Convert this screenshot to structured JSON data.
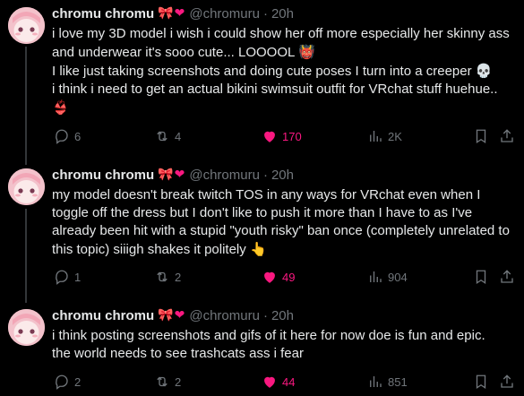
{
  "tweets": [
    {
      "name": "chromu chromu",
      "bow": "🎀",
      "heart": "❤",
      "handle": "@chromuru",
      "dot": "·",
      "time": "20h",
      "lines": [
        "i love my 3D model i wish i could show her off more especially her skinny ass and underwear it's sooo cute... LOOOOL",
        "I like just taking screenshots and doing cute poses I turn into a creeper",
        "i think i need to get an actual bikini swimsuit outfit for VRchat stuff huehue.."
      ],
      "emojis": [
        "👹",
        "💀",
        "👙"
      ],
      "replies": "6",
      "retweets": "4",
      "likes": "170",
      "views": "2K"
    },
    {
      "name": "chromu chromu",
      "bow": "🎀",
      "heart": "❤",
      "handle": "@chromuru",
      "dot": "·",
      "time": "20h",
      "text": "my model doesn't break twitch TOS in any ways for VRchat even when I toggle off the dress but I don't like to push it more than I have to as I've already been hit with a stupid \"youth risky\" ban once (completely unrelated to this topic) siiigh shakes it politely",
      "emoji": "👆",
      "replies": "1",
      "retweets": "2",
      "likes": "49",
      "views": "904"
    },
    {
      "name": "chromu chromu",
      "bow": "🎀",
      "heart": "❤",
      "handle": "@chromuru",
      "dot": "·",
      "time": "20h",
      "lines": [
        "i think posting screenshots and gifs of it here for now doe is fun and epic.",
        "the world needs to see trashcats ass i fear"
      ],
      "replies": "2",
      "retweets": "2",
      "likes": "44",
      "views": "851"
    }
  ],
  "colors": {
    "background": "#000000",
    "text": "#e7e9ea",
    "muted": "#71767b",
    "like": "#f91880"
  },
  "icons": [
    "reply-icon",
    "retweet-icon",
    "like-icon",
    "views-icon",
    "bookmark-icon",
    "share-icon"
  ]
}
